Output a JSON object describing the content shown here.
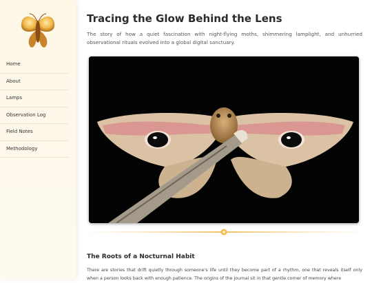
{
  "sidebar": {
    "logo_icon": "moth-logo-icon",
    "items": [
      {
        "label": "Home"
      },
      {
        "label": "About"
      },
      {
        "label": "Lamps"
      },
      {
        "label": "Observation Log"
      },
      {
        "label": "Field Notes"
      },
      {
        "label": "Methodology"
      }
    ]
  },
  "main": {
    "title": "Tracing the Glow Behind the Lens",
    "intro": "The story of how a quiet fascination with night-flying moths, shimmering lamplight, and unhurried observational rituals evolved into a global digital sanctuary.",
    "hero_image": "moth-on-branch-photo",
    "section": {
      "title": "The Roots of a Nocturnal Habit",
      "text_line1": "There are stories that drift quietly through someone's life until they become part of a rhythm, one that reveals itself only",
      "text_line2": "when a person looks back with enough patience. The origins of the journal sit in that gentle corner of memory where"
    }
  },
  "colors": {
    "accent": "#e8b24a",
    "sidebar_bg": "#fdf7e6",
    "title": "#2b2b2b"
  }
}
